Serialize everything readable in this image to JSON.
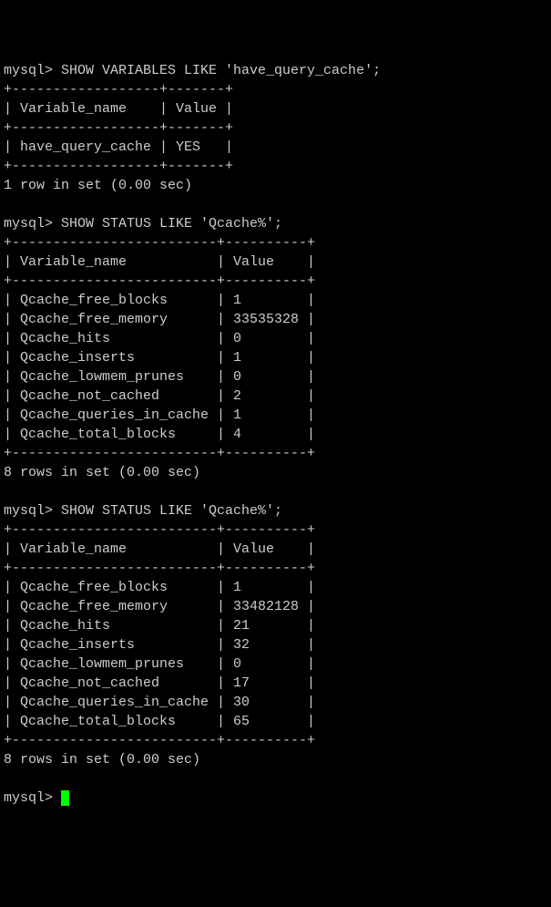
{
  "prompt": "mysql>",
  "queries": [
    {
      "command": "SHOW VARIABLES LIKE 'have_query_cache';",
      "header_divider": "+------------------+-------+",
      "header": "| Variable_name    | Value |",
      "rows": [
        "| have_query_cache | YES   |"
      ],
      "result_text": "1 row in set (0.00 sec)"
    },
    {
      "command": "SHOW STATUS LIKE 'Qcache%';",
      "header_divider": "+-------------------------+----------+",
      "header": "| Variable_name           | Value    |",
      "rows": [
        "| Qcache_free_blocks      | 1        |",
        "| Qcache_free_memory      | 33535328 |",
        "| Qcache_hits             | 0        |",
        "| Qcache_inserts          | 1        |",
        "| Qcache_lowmem_prunes    | 0        |",
        "| Qcache_not_cached       | 2        |",
        "| Qcache_queries_in_cache | 1        |",
        "| Qcache_total_blocks     | 4        |"
      ],
      "result_text": "8 rows in set (0.00 sec)"
    },
    {
      "command": "SHOW STATUS LIKE 'Qcache%';",
      "header_divider": "+-------------------------+----------+",
      "header": "| Variable_name           | Value    |",
      "rows": [
        "| Qcache_free_blocks      | 1        |",
        "| Qcache_free_memory      | 33482128 |",
        "| Qcache_hits             | 21       |",
        "| Qcache_inserts          | 32       |",
        "| Qcache_lowmem_prunes    | 0        |",
        "| Qcache_not_cached       | 17       |",
        "| Qcache_queries_in_cache | 30       |",
        "| Qcache_total_blocks     | 65       |"
      ],
      "result_text": "8 rows in set (0.00 sec)"
    }
  ],
  "chart_data": [
    {
      "type": "table",
      "title": "SHOW VARIABLES LIKE 'have_query_cache'",
      "columns": [
        "Variable_name",
        "Value"
      ],
      "rows": [
        [
          "have_query_cache",
          "YES"
        ]
      ]
    },
    {
      "type": "table",
      "title": "SHOW STATUS LIKE 'Qcache%' (first)",
      "columns": [
        "Variable_name",
        "Value"
      ],
      "rows": [
        [
          "Qcache_free_blocks",
          "1"
        ],
        [
          "Qcache_free_memory",
          "33535328"
        ],
        [
          "Qcache_hits",
          "0"
        ],
        [
          "Qcache_inserts",
          "1"
        ],
        [
          "Qcache_lowmem_prunes",
          "0"
        ],
        [
          "Qcache_not_cached",
          "2"
        ],
        [
          "Qcache_queries_in_cache",
          "1"
        ],
        [
          "Qcache_total_blocks",
          "4"
        ]
      ]
    },
    {
      "type": "table",
      "title": "SHOW STATUS LIKE 'Qcache%' (second)",
      "columns": [
        "Variable_name",
        "Value"
      ],
      "rows": [
        [
          "Qcache_free_blocks",
          "1"
        ],
        [
          "Qcache_free_memory",
          "33482128"
        ],
        [
          "Qcache_hits",
          "21"
        ],
        [
          "Qcache_inserts",
          "32"
        ],
        [
          "Qcache_lowmem_prunes",
          "0"
        ],
        [
          "Qcache_not_cached",
          "17"
        ],
        [
          "Qcache_queries_in_cache",
          "30"
        ],
        [
          "Qcache_total_blocks",
          "65"
        ]
      ]
    }
  ]
}
